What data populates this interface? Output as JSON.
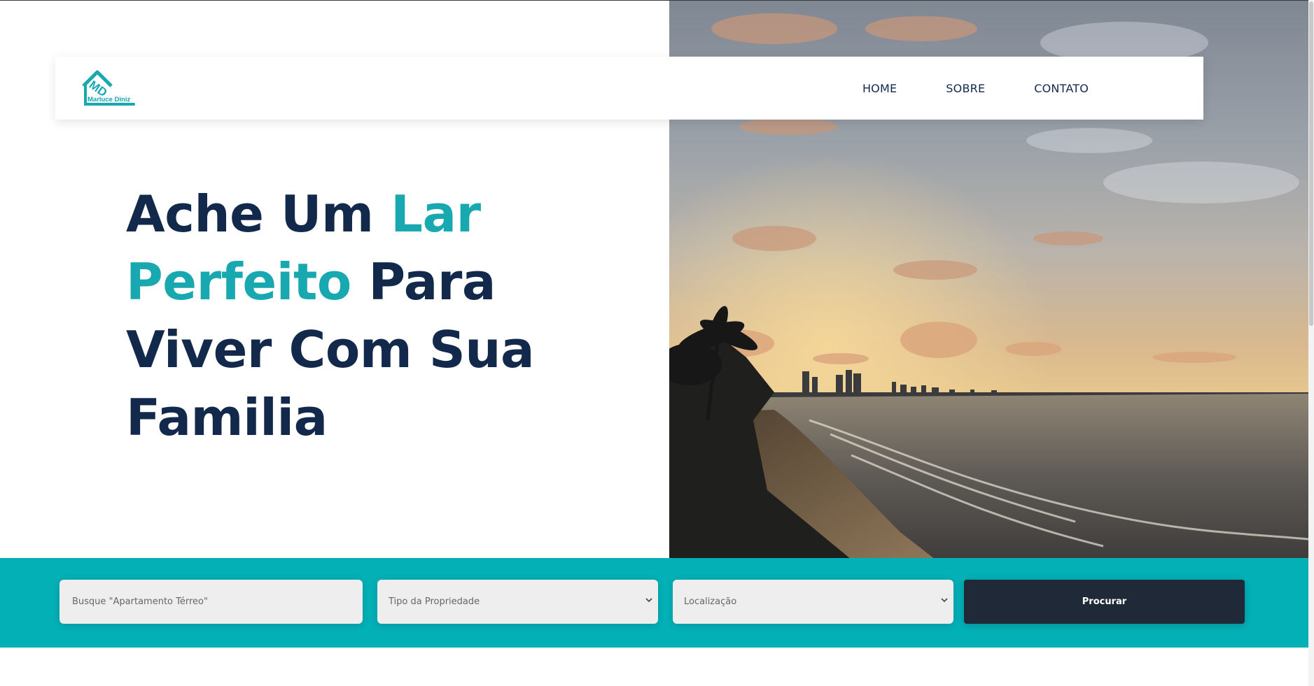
{
  "brand": {
    "name": "Marluce Diniz",
    "monogram": "MD",
    "accent_color": "#18a8b0",
    "dark_color": "#13294b"
  },
  "nav": {
    "items": [
      {
        "label": "HOME"
      },
      {
        "label": "SOBRE"
      },
      {
        "label": "CONTATO"
      }
    ]
  },
  "hero": {
    "line1_a": "Ache Um ",
    "line1_b": "Lar",
    "line2_a": "Perfeito",
    "line2_b": " Para",
    "line3": "Viver Com Sua",
    "line4": "Familia",
    "image": "sunset-beach-photo"
  },
  "search": {
    "query_placeholder": "Busque \"Apartamento Térreo\"",
    "property_type": "Tipo da Propriedade",
    "location": "Localização",
    "submit_label": "Procurar",
    "band_color": "#03b0b6",
    "button_color": "#1f2937"
  }
}
